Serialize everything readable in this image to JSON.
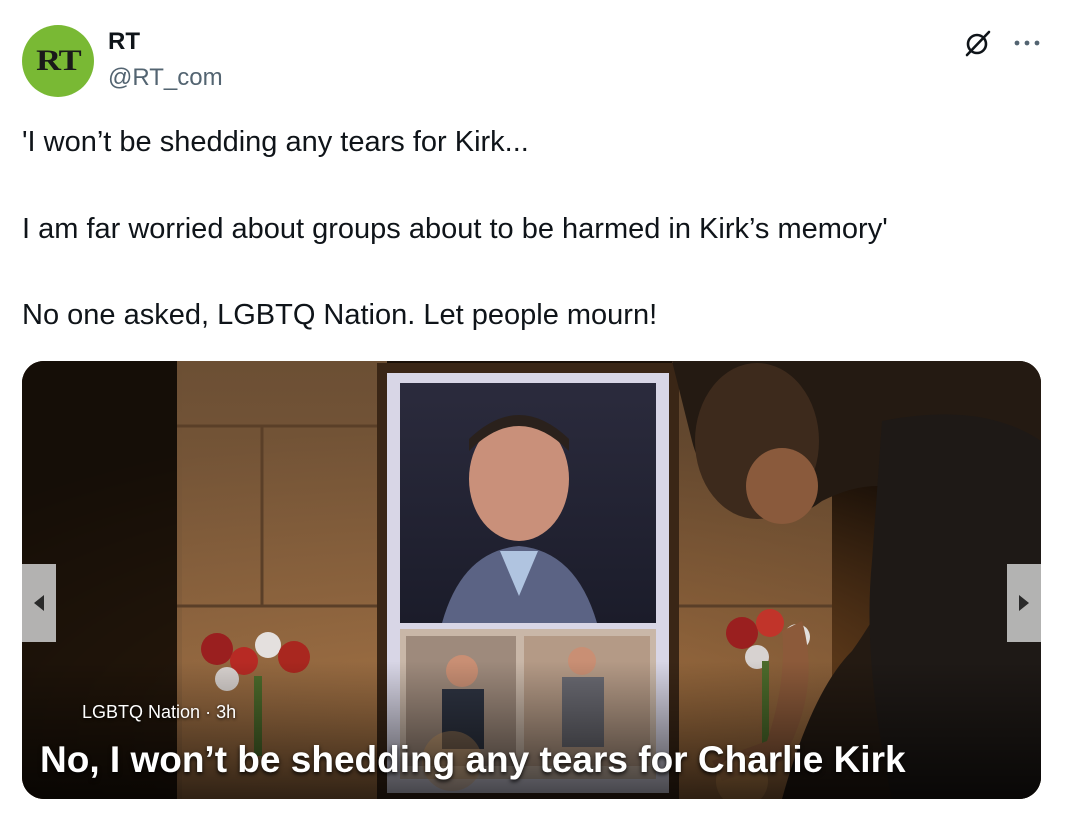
{
  "author": {
    "avatar_text": "RT",
    "display_name": "RT",
    "handle": "@RT_com"
  },
  "header_icons": {
    "grok": "grok-icon",
    "more": "more-icon"
  },
  "tweet": {
    "lines": [
      "'I won’t be shedding any tears for Kirk...",
      "I am far worried about groups about to be harmed in Kirk’s memory'",
      "No one asked, LGBTQ Nation. Let people mourn!"
    ]
  },
  "media": {
    "source": "LGBTQ Nation",
    "age": "3h",
    "headline": "No, I won’t be shedding any tears for Charlie Kirk",
    "prev_icon": "chevron-left-icon",
    "next_icon": "chevron-right-icon"
  },
  "colors": {
    "avatar_bg": "#79b934",
    "text": "#0f1419",
    "secondary_text": "#536471"
  }
}
